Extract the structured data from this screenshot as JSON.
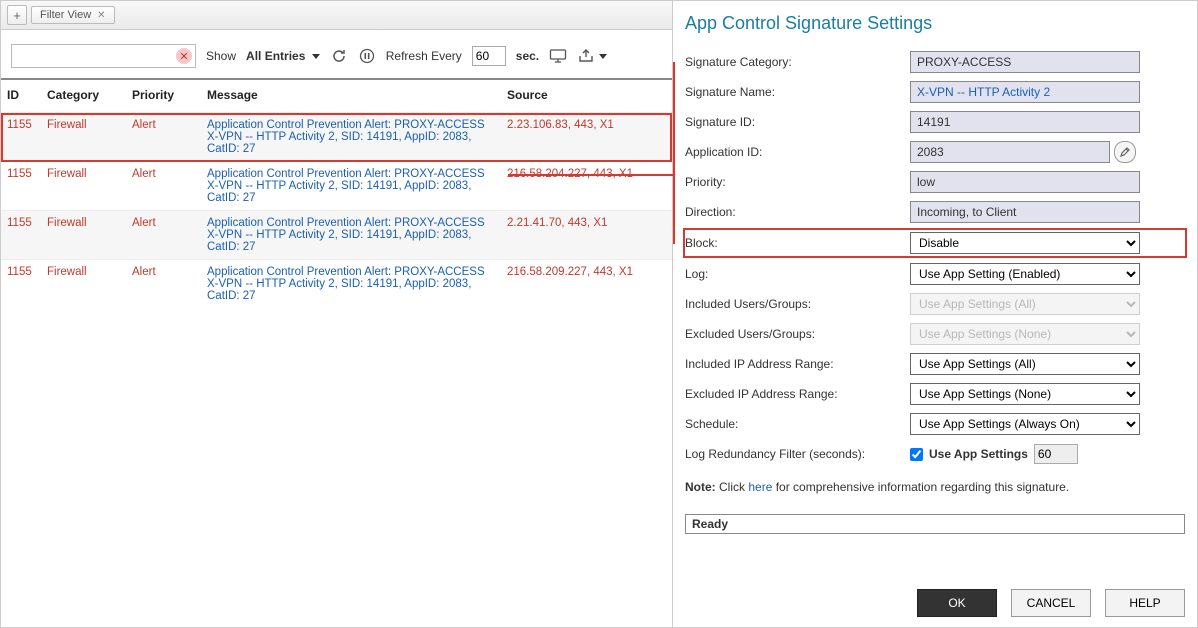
{
  "tabs": {
    "filter_view": "Filter View"
  },
  "toolbar": {
    "show_label": "Show",
    "show_value": "All Entries",
    "refresh_every": "Refresh Every",
    "refresh_interval": "60",
    "sec": "sec."
  },
  "table": {
    "headers": {
      "id": "ID",
      "category": "Category",
      "priority": "Priority",
      "message": "Message",
      "source": "Source"
    },
    "rows": [
      {
        "id": "1155",
        "category": "Firewall",
        "priority": "Alert",
        "message": "Application Control Prevention Alert: PROXY-ACCESS X-VPN -- HTTP Activity 2, SID: 14191, AppID: 2083, CatID: 27",
        "source": "2.23.106.83, 443, X1",
        "highlight": true
      },
      {
        "id": "1155",
        "category": "Firewall",
        "priority": "Alert",
        "message": "Application Control Prevention Alert: PROXY-ACCESS X-VPN -- HTTP Activity 2, SID: 14191, AppID: 2083, CatID: 27",
        "source": "216.58.204.227, 443, X1"
      },
      {
        "id": "1155",
        "category": "Firewall",
        "priority": "Alert",
        "message": "Application Control Prevention Alert: PROXY-ACCESS X-VPN -- HTTP Activity 2, SID: 14191, AppID: 2083, CatID: 27",
        "source": "2.21.41.70, 443, X1"
      },
      {
        "id": "1155",
        "category": "Firewall",
        "priority": "Alert",
        "message": "Application Control Prevention Alert: PROXY-ACCESS X-VPN -- HTTP Activity 2, SID: 14191, AppID: 2083, CatID: 27",
        "source": "216.58.209.227, 443, X1"
      }
    ]
  },
  "settings": {
    "title": "App Control Signature Settings",
    "labels": {
      "sig_category": "Signature Category:",
      "sig_name": "Signature Name:",
      "sig_id": "Signature ID:",
      "app_id": "Application ID:",
      "priority": "Priority:",
      "direction": "Direction:",
      "block": "Block:",
      "log": "Log:",
      "inc_users": "Included Users/Groups:",
      "exc_users": "Excluded Users/Groups:",
      "inc_ip": "Included IP Address Range:",
      "exc_ip": "Excluded IP Address Range:",
      "schedule": "Schedule:",
      "log_redundancy": "Log Redundancy Filter (seconds):",
      "use_app_settings": "Use App Settings"
    },
    "values": {
      "sig_category": "PROXY-ACCESS",
      "sig_name": "X-VPN -- HTTP Activity 2",
      "sig_id": "14191",
      "app_id": "2083",
      "priority": "low",
      "direction": "Incoming, to Client",
      "block": "Disable",
      "log": "Use App Setting (Enabled)",
      "inc_users": "Use App Settings (All)",
      "exc_users": "Use App Settings (None)",
      "inc_ip": "Use App Settings (All)",
      "exc_ip": "Use App Settings (None)",
      "schedule": "Use App Settings (Always On)",
      "log_redundancy": "60"
    },
    "note_prefix": "Note:",
    "note_click": " Click ",
    "note_here": "here",
    "note_suffix": " for comprehensive information regarding this signature.",
    "status": "Ready",
    "buttons": {
      "ok": "OK",
      "cancel": "CANCEL",
      "help": "HELP"
    }
  }
}
